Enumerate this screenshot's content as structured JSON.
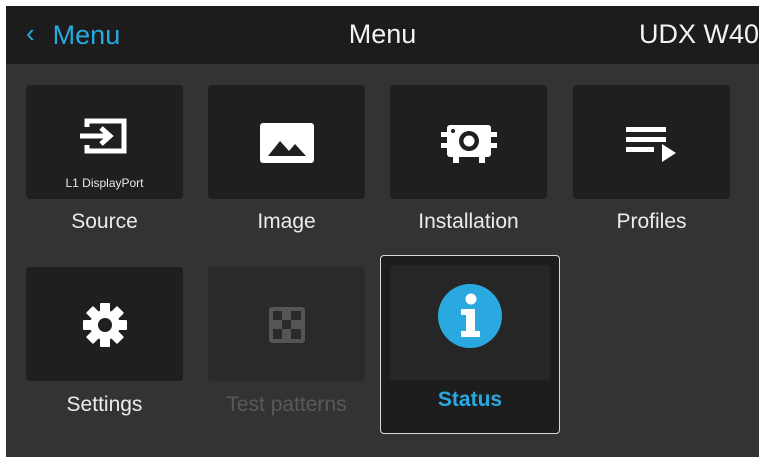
{
  "header": {
    "back_label": "Menu",
    "title": "Menu",
    "device": "UDX W40"
  },
  "tiles": [
    {
      "label": "Source",
      "sublabel": "L1 DisplayPort",
      "icon": "source-input-icon",
      "disabled": false
    },
    {
      "label": "Image",
      "icon": "image-icon",
      "disabled": false
    },
    {
      "label": "Installation",
      "icon": "projector-icon",
      "disabled": false
    },
    {
      "label": "Profiles",
      "icon": "playlist-icon",
      "disabled": false
    },
    {
      "label": "Settings",
      "icon": "gear-icon",
      "disabled": false
    },
    {
      "label": "Test patterns",
      "icon": "checkerboard-icon",
      "disabled": true
    },
    {
      "label": "Status",
      "icon": "info-icon",
      "selected": true
    }
  ],
  "colors": {
    "accent": "#29a9e0",
    "background": "#333333",
    "header": "#1c1c1c",
    "tile": "#1f1f1f",
    "disabled_text": "#595959"
  }
}
